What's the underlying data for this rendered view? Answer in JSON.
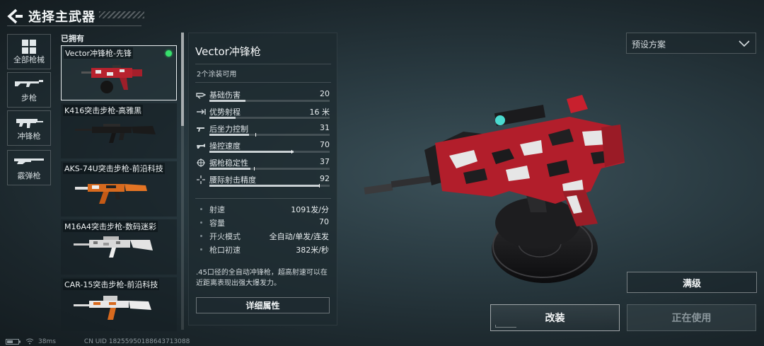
{
  "header": {
    "title": "选择主武器"
  },
  "categories": [
    {
      "label": "全部枪械",
      "icon": "grid-icon"
    },
    {
      "label": "步枪",
      "icon": "rifle-icon"
    },
    {
      "label": "冲锋枪",
      "icon": "smg-icon"
    },
    {
      "label": "霰弹枪",
      "icon": "shotgun-icon"
    }
  ],
  "owned": {
    "label": "已拥有",
    "weapons": [
      {
        "name": "Vector冲锋枪-先锋",
        "selected": true,
        "equipped": true
      },
      {
        "name": "K416突击步枪-高雅黑"
      },
      {
        "name": "AKS-74U突击步枪-前沿科技"
      },
      {
        "name": "M16A4突击步枪-数码迷彩"
      },
      {
        "name": "CAR-15突击步枪-前沿科技"
      }
    ]
  },
  "detail": {
    "name": "Vector冲锋枪",
    "skins": "2个涂装可用",
    "stats": [
      {
        "label": "基础伤害",
        "value": "20",
        "fill": 0.3,
        "icon": "damage-icon"
      },
      {
        "label": "优势射程",
        "value": "16 米",
        "fill": 0.22,
        "icon": "range-icon"
      },
      {
        "label": "后坐力控制",
        "value": "31",
        "fill": 0.33,
        "mark": 0.38,
        "icon": "recoil-icon"
      },
      {
        "label": "操控速度",
        "value": "70",
        "fill": 0.7,
        "mark": 0.68,
        "icon": "handling-icon"
      },
      {
        "label": "据枪稳定性",
        "value": "37",
        "fill": 0.34,
        "mark": 0.37,
        "icon": "stability-icon"
      },
      {
        "label": "腰际射击精度",
        "value": "92",
        "fill": 0.92,
        "mark": 0.91,
        "icon": "crosshair-icon"
      }
    ],
    "specs": [
      {
        "label": "射速",
        "value": "1091发/分"
      },
      {
        "label": "容量",
        "value": "70"
      },
      {
        "label": "开火模式",
        "value": "全自动/单发/连发"
      },
      {
        "label": "枪口初速",
        "value": "382米/秒"
      }
    ],
    "description": ".45口径的全自动冲锋枪，超高射速可以在近距离表现出强大爆发力。",
    "attr_button": "详细属性"
  },
  "preset": {
    "label": "预设方案"
  },
  "buttons": {
    "max": "满级",
    "modify": "改装",
    "in_use": "正在使用"
  },
  "footer": {
    "ping": "38ms",
    "uid": "CN UID 18255950188643713088"
  },
  "colors": {
    "equipped_dot": "#37e06c",
    "accent_red": "#c3202e"
  }
}
